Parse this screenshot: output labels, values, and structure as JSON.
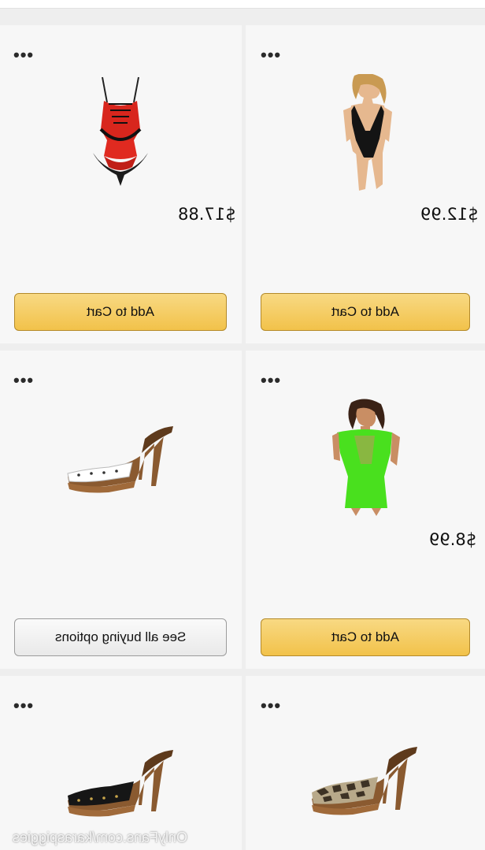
{
  "products": [
    {
      "price": "$17.88",
      "button": "Add to Cart",
      "image_icon": "red-black-lace-teddy-lingerie"
    },
    {
      "price": "$12.99",
      "button": "Add to Cart",
      "image_icon": "black-lace-bodysuit-model"
    },
    {
      "price": "",
      "button": "See all buying options",
      "image_icon": "white-wooden-clog-high-heel"
    },
    {
      "price": "$8.99",
      "button": "Add to Cart",
      "image_icon": "green-fishnet-dress-model"
    },
    {
      "price": "",
      "button": "",
      "image_icon": "black-wooden-clog-high-heel"
    },
    {
      "price": "",
      "button": "",
      "image_icon": "snakeskin-wooden-clog-high-heel"
    }
  ],
  "more_options_icon": "ellipsis-icon",
  "watermark": "OnlyFans.com/karaspiggies",
  "colors": {
    "cart_button": "#f2c24a",
    "options_button": "#ececec",
    "card_bg": "#f7f7f7"
  }
}
